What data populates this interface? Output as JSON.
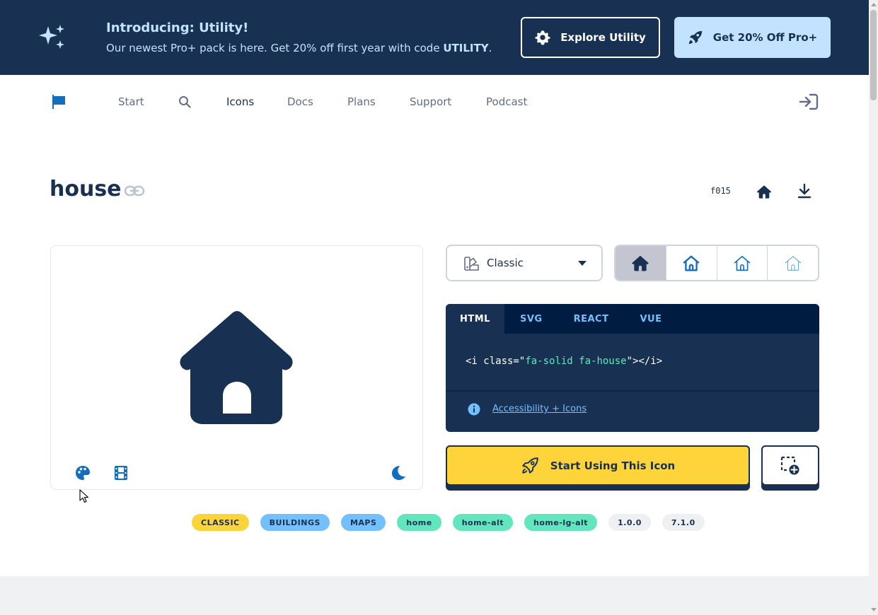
{
  "banner": {
    "title": "Introducing: Utility!",
    "subtitle_prefix": "Our newest Pro+ pack is here. Get 20% off first year with code ",
    "subtitle_code": "UTILITY",
    "subtitle_suffix": ".",
    "explore_label": "Explore Utility",
    "pro_label": "Get 20% Off Pro+",
    "icons": [
      "sparkles-icon",
      "gear-icon",
      "rocket-icon"
    ]
  },
  "nav": {
    "items": [
      {
        "label": "Start"
      },
      {
        "label": "Icons",
        "active": true
      },
      {
        "label": "Docs"
      },
      {
        "label": "Plans"
      },
      {
        "label": "Support"
      },
      {
        "label": "Podcast"
      }
    ],
    "icons": [
      "flag-icon",
      "search-icon",
      "sign-in-icon"
    ]
  },
  "icon_detail": {
    "name": "house",
    "unicode": "f015"
  },
  "preview": {
    "tools": [
      "palette-icon",
      "film-icon",
      "moon-icon"
    ]
  },
  "style_select": {
    "value": "Classic"
  },
  "variants": [
    "solid",
    "regular",
    "light",
    "thin"
  ],
  "code": {
    "tabs": [
      "HTML",
      "SVG",
      "REACT",
      "VUE"
    ],
    "active_tab": "HTML",
    "line_open": "<i class=\"",
    "line_class": "fa-solid fa-house",
    "line_close": "\"></i>",
    "a11y_link": "Accessibility + Icons"
  },
  "cta": {
    "start_label": "Start Using This Icon"
  },
  "tags": [
    {
      "label": "CLASSIC",
      "color": "yellow"
    },
    {
      "label": "BUILDINGS",
      "color": "blue"
    },
    {
      "label": "MAPS",
      "color": "blue"
    },
    {
      "label": "home",
      "color": "green"
    },
    {
      "label": "home-alt",
      "color": "green"
    },
    {
      "label": "home-lg-alt",
      "color": "green"
    },
    {
      "label": "1.0.0",
      "color": "gray"
    },
    {
      "label": "7.1.0",
      "color": "gray"
    }
  ],
  "colors": {
    "navy": "#183153",
    "banner_text": "#c3e2ff",
    "yellow": "#ffd43b",
    "blue": "#74c0fc",
    "green": "#63e6be",
    "accent_blue": "#146ebe"
  }
}
